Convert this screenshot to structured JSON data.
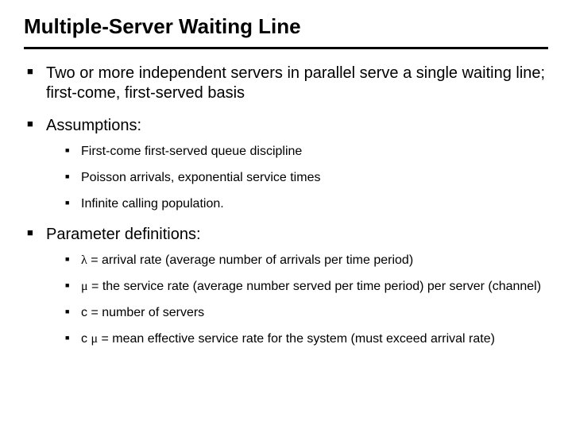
{
  "title": "Multiple-Server Waiting Line",
  "bullets": {
    "b1": "Two or more independent servers in parallel serve a single waiting line; first-come, first-served basis",
    "b2": "Assumptions:",
    "b2_sub": {
      "s1": "First-come first-served queue discipline",
      "s2": "Poisson arrivals, exponential service times",
      "s3": "Infinite calling population."
    },
    "b3": "Parameter definitions:",
    "b3_sub": {
      "s1_pre": "λ",
      "s1_post": " = arrival rate (average number of arrivals per time period)",
      "s2_pre": "μ",
      "s2_post": " = the service rate (average number served per time    period) per server (channel)",
      "s3": "c = number of servers",
      "s4_pre": "c ",
      "s4_mid": "μ",
      "s4_post": " = mean effective service rate for the system (must    exceed arrival rate)"
    }
  }
}
